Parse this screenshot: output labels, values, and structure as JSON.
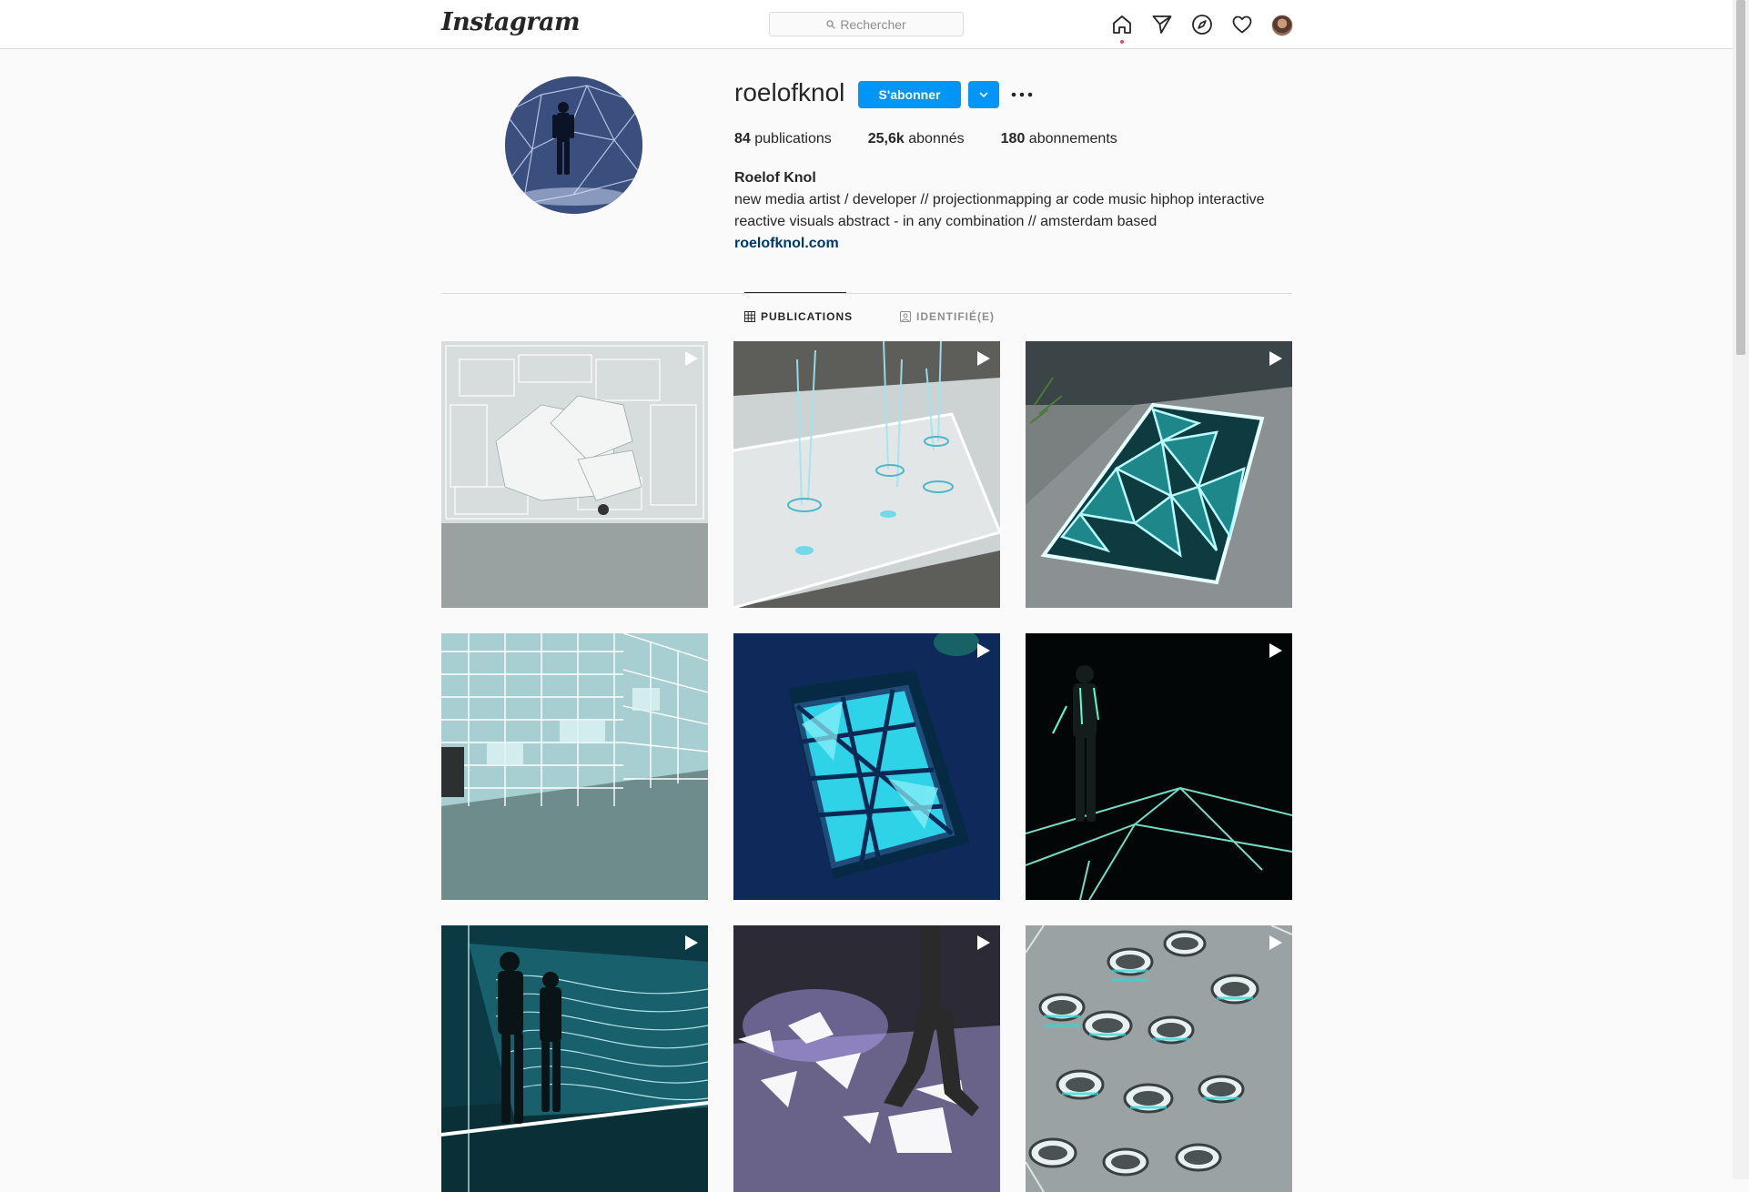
{
  "app": {
    "logo": "Instagram"
  },
  "search": {
    "placeholder": "Rechercher"
  },
  "nav": {
    "icons": [
      "home-icon",
      "direct-icon",
      "explore-icon",
      "activity-heart-icon",
      "profile-avatar"
    ]
  },
  "profile": {
    "username": "roelofknol",
    "follow_label": "S'abonner",
    "stats": {
      "posts_count": "84",
      "posts_label": "publications",
      "followers_count": "25,6k",
      "followers_label": "abonnés",
      "following_count": "180",
      "following_label": "abonnements"
    },
    "full_name": "Roelof Knol",
    "bio_line1": "new media artist / developer // projectionmapping ar code music hiphop interactive",
    "bio_line2": "reactive visuals abstract - in any combination // amsterdam based",
    "website": "roelofknol.com"
  },
  "tabs": [
    {
      "label": "PUBLICATIONS",
      "active": true
    },
    {
      "label": "IDENTIFIÉ(E)",
      "active": false
    }
  ],
  "posts": [
    {
      "type": "video"
    },
    {
      "type": "video"
    },
    {
      "type": "video"
    },
    {
      "type": "image"
    },
    {
      "type": "video"
    },
    {
      "type": "video"
    },
    {
      "type": "video"
    },
    {
      "type": "video"
    },
    {
      "type": "video"
    }
  ],
  "colors": {
    "accent": "#0095f6",
    "link": "#00376b",
    "notification": "#ed4956"
  }
}
